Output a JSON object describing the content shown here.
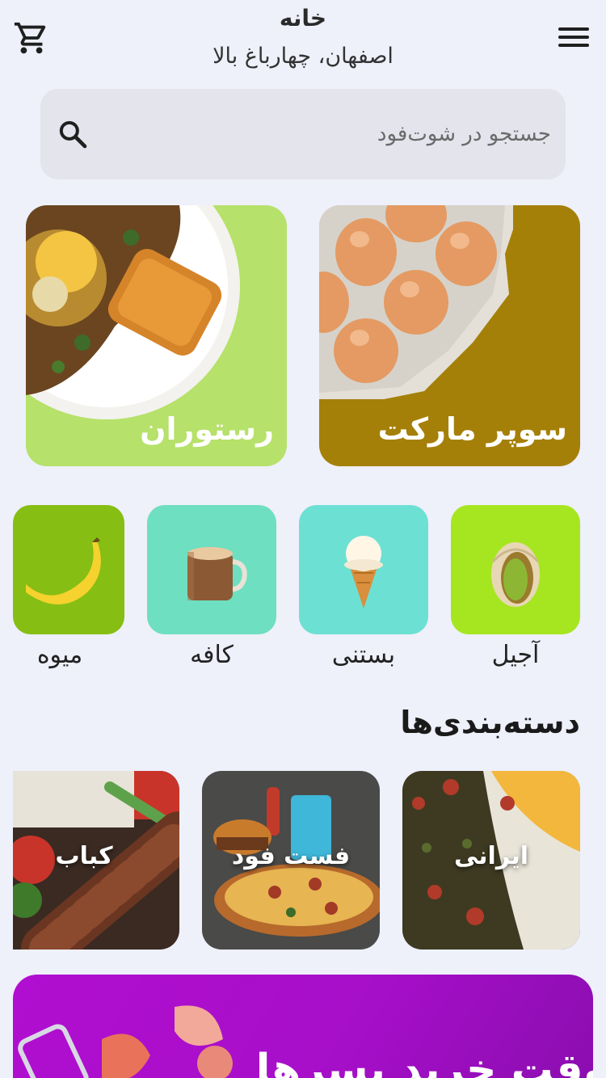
{
  "header": {
    "title": "خانه",
    "location": "اصفهان، چهارباغ بالا",
    "cart_icon": "shopping-cart-icon",
    "menu_icon": "hamburger-menu-icon"
  },
  "search": {
    "placeholder": "جستجو در شوت‌فود",
    "icon": "search-icon"
  },
  "main_cards": [
    {
      "label": "رستوران",
      "color": "#B6E16A"
    },
    {
      "label": "سوپر مارکت",
      "color": "#A58009"
    }
  ],
  "quick_categories": [
    {
      "label": "آجیل",
      "color": "#A6E620"
    },
    {
      "label": "بستنی",
      "color": "#6DE0D4"
    },
    {
      "label": "کافه",
      "color": "#6EDFC0"
    },
    {
      "label": "میوه",
      "color": "#86BE13"
    }
  ],
  "categories_section": {
    "title": "دسته‌بندی‌ها",
    "items": [
      {
        "label": "ایرانی"
      },
      {
        "label": "فست فود"
      },
      {
        "label": "کباب"
      }
    ]
  },
  "promo_banner": {
    "label": "وقت خرید پسرها",
    "color": "#A70FC9"
  }
}
